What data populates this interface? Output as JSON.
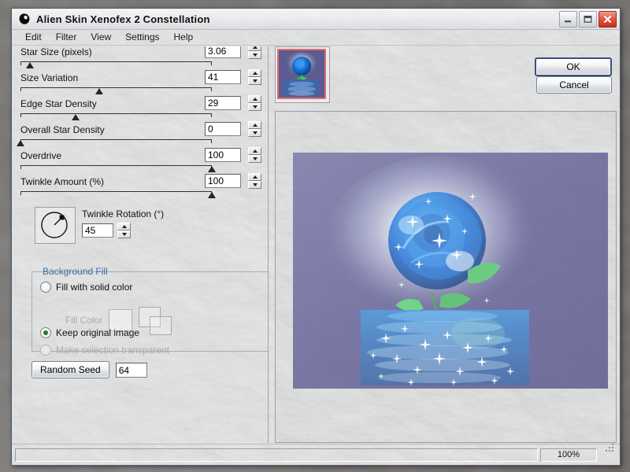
{
  "window": {
    "title": "Alien Skin Xenofex 2 Constellation",
    "app_icon": "alien-eye-icon",
    "buttons": {
      "minimize": "minimize-icon",
      "maximize": "maximize-icon",
      "close": "close-icon"
    }
  },
  "menu": {
    "items": [
      "Edit",
      "Filter",
      "View",
      "Settings",
      "Help"
    ]
  },
  "sliders": [
    {
      "label": "Star Size (pixels)",
      "value": "3.06",
      "percent": 5
    },
    {
      "label": "Size Variation",
      "value": "41",
      "percent": 41
    },
    {
      "label": "Edge Star Density",
      "value": "29",
      "percent": 29
    },
    {
      "label": "Overall Star Density",
      "value": "0",
      "percent": 0
    },
    {
      "label": "Overdrive",
      "value": "100",
      "percent": 100
    },
    {
      "label": "Twinkle Amount (%)",
      "value": "100",
      "percent": 100
    }
  ],
  "rotation": {
    "label": "Twinkle Rotation (°)",
    "value": "45",
    "angle_degrees": 45,
    "dial_icon": "rotation-dial"
  },
  "background_fill": {
    "legend": "Background Fill",
    "options": [
      {
        "label": "Fill with solid color",
        "selected": false,
        "disabled": false
      },
      {
        "label": "Keep original image",
        "selected": true,
        "disabled": false
      },
      {
        "label": "Make selection transparent",
        "selected": false,
        "disabled": true
      }
    ],
    "fill_color_label": "Fill Color",
    "fill_color_disabled": true
  },
  "random_seed": {
    "button_label": "Random Seed",
    "value": "64"
  },
  "preview": {
    "thumbnail_alt": "blue-rose-thumbnail",
    "image_alt": "blue-rose-with-reflection-preview",
    "tools": [
      {
        "name": "compare-split-icon",
        "active": true
      },
      {
        "name": "hand-pan-icon",
        "active": false
      },
      {
        "name": "zoom-magnifier-icon",
        "active": false
      }
    ]
  },
  "actions": {
    "ok": "OK",
    "cancel": "Cancel"
  },
  "statusbar": {
    "message": "",
    "zoom": "100%",
    "grip": "resize-grip-icon"
  },
  "colors": {
    "accent_blue": "#3a6ea5",
    "thumb_border": "#e06c6c",
    "radio_on": "#1f7a2e",
    "close_red": "#c62f1b",
    "rose_blue": "#1a6fd4",
    "leaf_green": "#45c160",
    "bg_purple": "#5c5b92"
  }
}
